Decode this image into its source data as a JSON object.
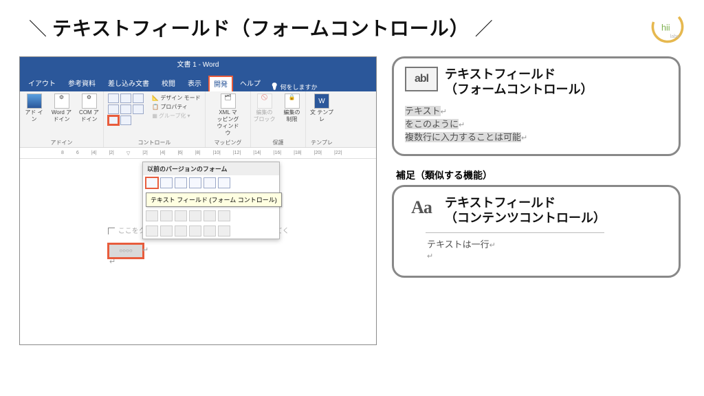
{
  "title": "テキストフィールド（フォームコントロール）",
  "word": {
    "windowTitle": "文書 1 - Word",
    "tabs": [
      "イアウト",
      "参考資料",
      "差し込み文書",
      "校閲",
      "表示",
      "開発",
      "ヘルプ"
    ],
    "activeTab": "開発",
    "tellMe": "何をしますか",
    "groups": {
      "addin": {
        "label": "アドイン",
        "items": [
          "アド\nイン",
          "Word\nアドイン",
          "COM\nアドイン"
        ]
      },
      "controls": {
        "label": "コントロール",
        "designMode": "デザイン モード",
        "properties": "プロパティ",
        "group": "グループ化"
      },
      "mapping": {
        "label": "マッピング",
        "item": "XML マッピング\nウィンドウ"
      },
      "protect": {
        "label": "保護",
        "items": [
          "編集の\nブロック",
          "編集の\n制限"
        ]
      },
      "template": {
        "label": "テンプレ",
        "item": "文\nテンプレ"
      }
    },
    "legacyHeader": "以前のバージョンのフォーム",
    "tooltip": "テキスト フィールド (フォーム コントロール)",
    "placeholder": "ここをクリックまたはタップしてテキストを入力してく",
    "fieldSample": "○○○○"
  },
  "panel1": {
    "iconText": "abl",
    "title": "テキストフィールド\n（フォームコントロール）",
    "lines": [
      "テキスト",
      "をこのように",
      "複数行に入力することは可能"
    ]
  },
  "supp": "補足（類似する機能）",
  "panel2": {
    "iconText": "Aa",
    "title": "テキストフィールド\n（コンテンツコントロール）",
    "sample": "テキストは一行"
  }
}
